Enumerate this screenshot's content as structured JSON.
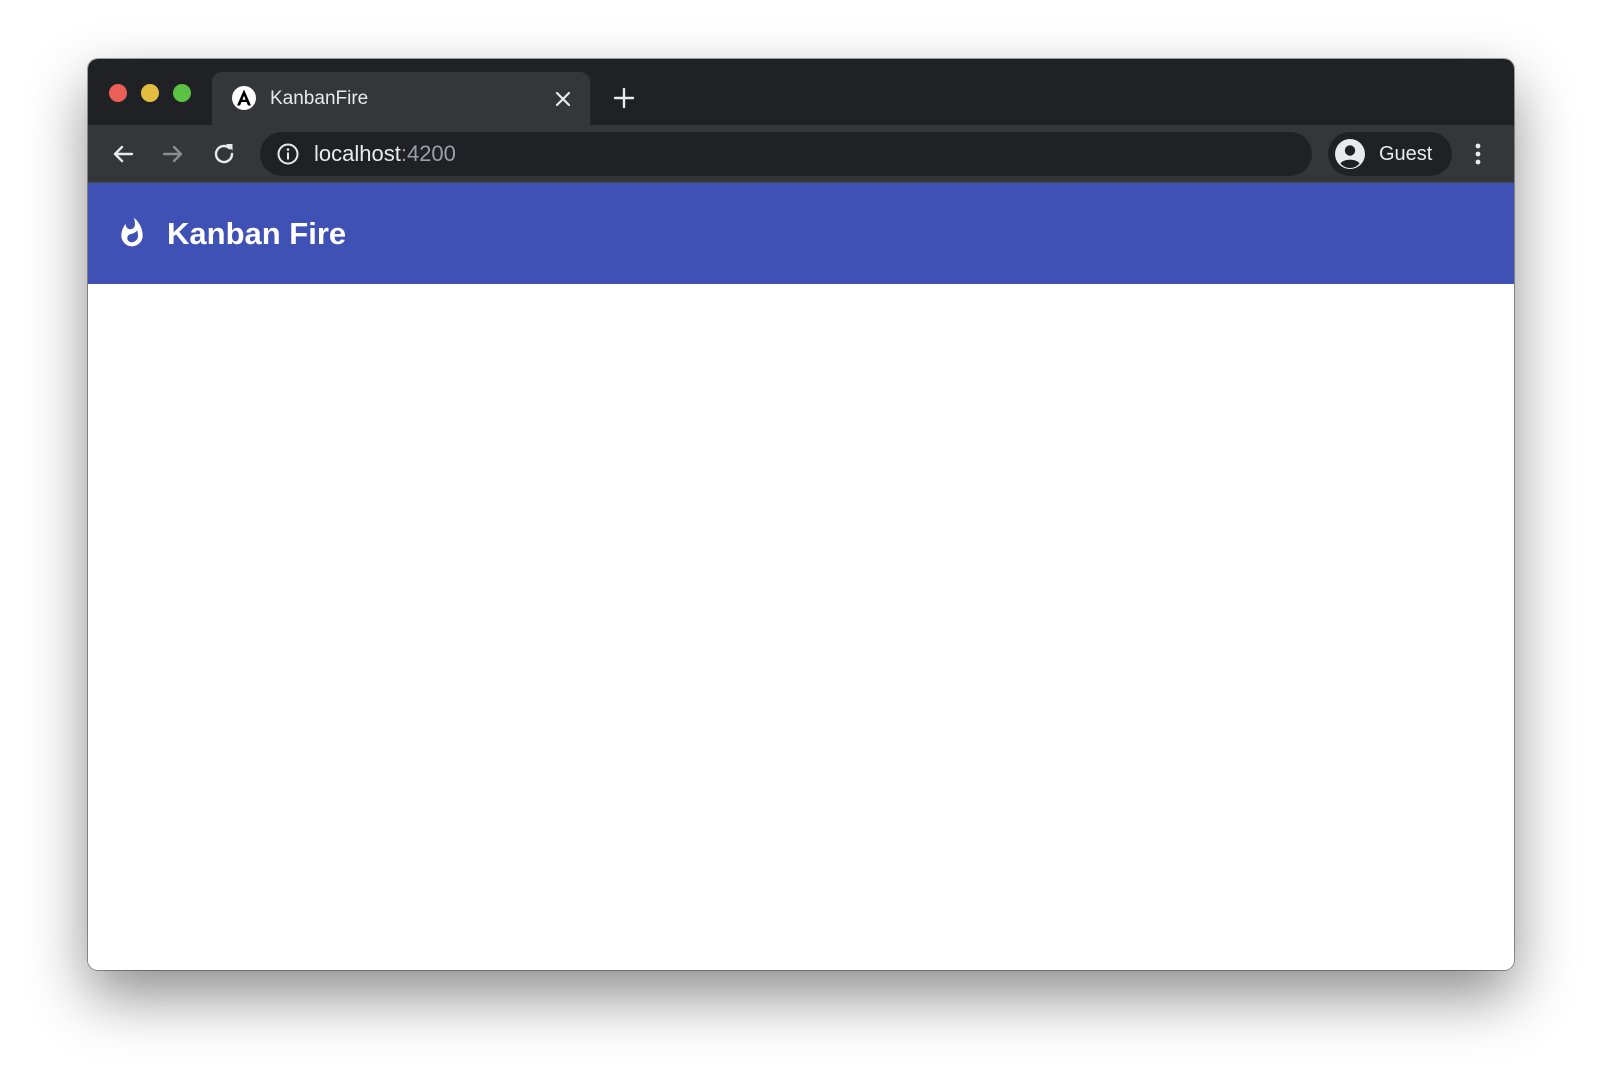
{
  "browser": {
    "tab": {
      "title": "KanbanFire",
      "favicon": "angular-icon"
    },
    "address": {
      "host": "localhost",
      "port": ":4200"
    },
    "profile": {
      "name": "Guest"
    }
  },
  "app": {
    "title": "Kanban Fire",
    "logo_icon": "whatshot-flame-icon",
    "theme_color": "#3f51b5"
  },
  "colors": {
    "titlebar": "#202124",
    "toolbar": "#35363a",
    "traffic_red": "#ec5f57",
    "traffic_yellow": "#e2bd3f",
    "traffic_green": "#5bc244"
  }
}
